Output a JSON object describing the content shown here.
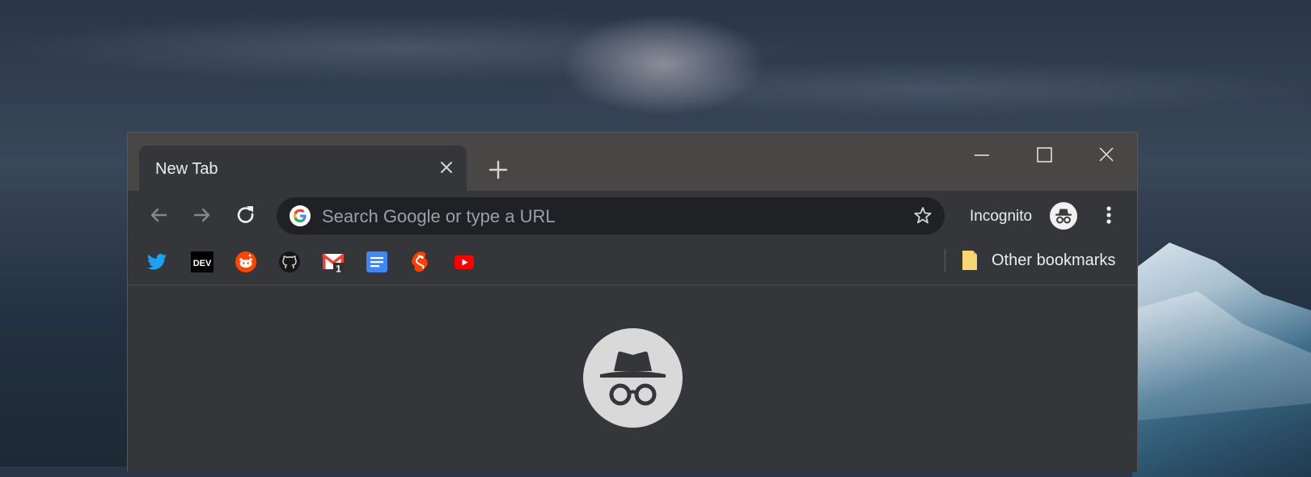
{
  "tab": {
    "title": "New Tab"
  },
  "omnibox": {
    "placeholder": "Search Google or type a URL"
  },
  "profile": {
    "label": "Incognito"
  },
  "bookmarks": {
    "items": [
      {
        "name": "twitter-icon",
        "color": "#1da1f2"
      },
      {
        "name": "dev-icon",
        "color": "#000000",
        "text": "DEV"
      },
      {
        "name": "reddit-icon",
        "color": "#ff4500"
      },
      {
        "name": "github-icon",
        "color": "#181717"
      },
      {
        "name": "gmail-icon",
        "color": "#ea4335",
        "badge": "1"
      },
      {
        "name": "google-docs-icon",
        "color": "#4285f4"
      },
      {
        "name": "svelte-icon",
        "color": "#ff3e00"
      },
      {
        "name": "youtube-icon",
        "color": "#ff0000"
      }
    ],
    "other_label": "Other bookmarks"
  },
  "colors": {
    "titlebar": "#494745",
    "toolbar": "#35363a",
    "omnibox": "#202124"
  }
}
